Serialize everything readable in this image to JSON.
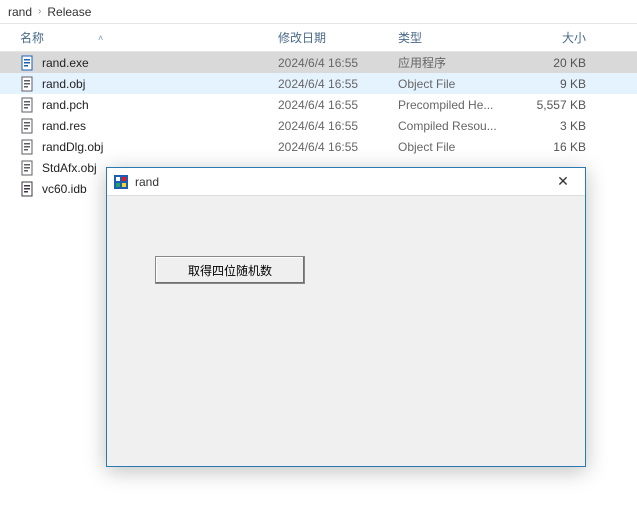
{
  "breadcrumb": {
    "part1": "rand",
    "part2": "Release"
  },
  "columns": {
    "name": "名称",
    "date": "修改日期",
    "type": "类型",
    "size": "大小"
  },
  "files": [
    {
      "name": "rand.exe",
      "date": "2024/6/4 16:55",
      "type": "应用程序",
      "size": "20 KB",
      "iconColor": "#1a5fb4",
      "selected": true
    },
    {
      "name": "rand.obj",
      "date": "2024/6/4 16:55",
      "type": "Object File",
      "size": "9 KB",
      "iconColor": "#5e5c64",
      "hover": true
    },
    {
      "name": "rand.pch",
      "date": "2024/6/4 16:55",
      "type": "Precompiled He...",
      "size": "5,557 KB",
      "iconColor": "#5e5c64"
    },
    {
      "name": "rand.res",
      "date": "2024/6/4 16:55",
      "type": "Compiled Resou...",
      "size": "3 KB",
      "iconColor": "#5e5c64"
    },
    {
      "name": "randDlg.obj",
      "date": "2024/6/4 16:55",
      "type": "Object File",
      "size": "16 KB",
      "iconColor": "#5e5c64"
    },
    {
      "name": "StdAfx.obj",
      "date": "",
      "type": "",
      "size": "",
      "iconColor": "#5e5c64"
    },
    {
      "name": "vc60.idb",
      "date": "",
      "type": "",
      "size": "",
      "iconColor": "#3d3846"
    }
  ],
  "dialog": {
    "title": "rand",
    "button": "取得四位随机数",
    "close": "✕"
  }
}
